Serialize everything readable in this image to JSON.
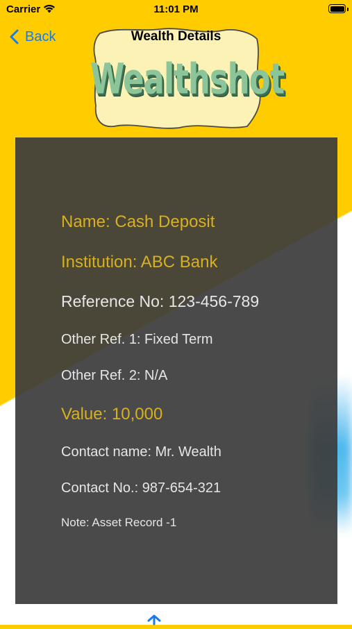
{
  "status_bar": {
    "carrier": "Carrier",
    "time": "11:01 PM"
  },
  "nav": {
    "back_label": "Back",
    "title": "Wealth Details"
  },
  "logo": {
    "text": "Wealthshot"
  },
  "details": {
    "name": "Name: Cash Deposit",
    "institution": "Institution: ABC Bank",
    "reference_no": "Reference No: 123-456-789",
    "other_ref_1": "Other Ref. 1: Fixed Term",
    "other_ref_2": "Other Ref. 2: N/A",
    "value": "Value: 10,000",
    "contact_name": "Contact name: Mr. Wealth",
    "contact_no": "Contact No.: 987-654-321",
    "note": "Note: Asset Record -1"
  },
  "icons": {
    "wifi": "wifi-icon",
    "battery": "battery-icon",
    "back": "chevron-left-icon",
    "scroll_top": "arrow-up-icon"
  },
  "colors": {
    "background_yellow": "#ffcc00",
    "panel": "#3c3c3c",
    "gold_text": "#d8b01f",
    "light_text": "#e6e6e6",
    "accent_blue": "#1a7be8",
    "logo_green": "#8cc59a"
  }
}
